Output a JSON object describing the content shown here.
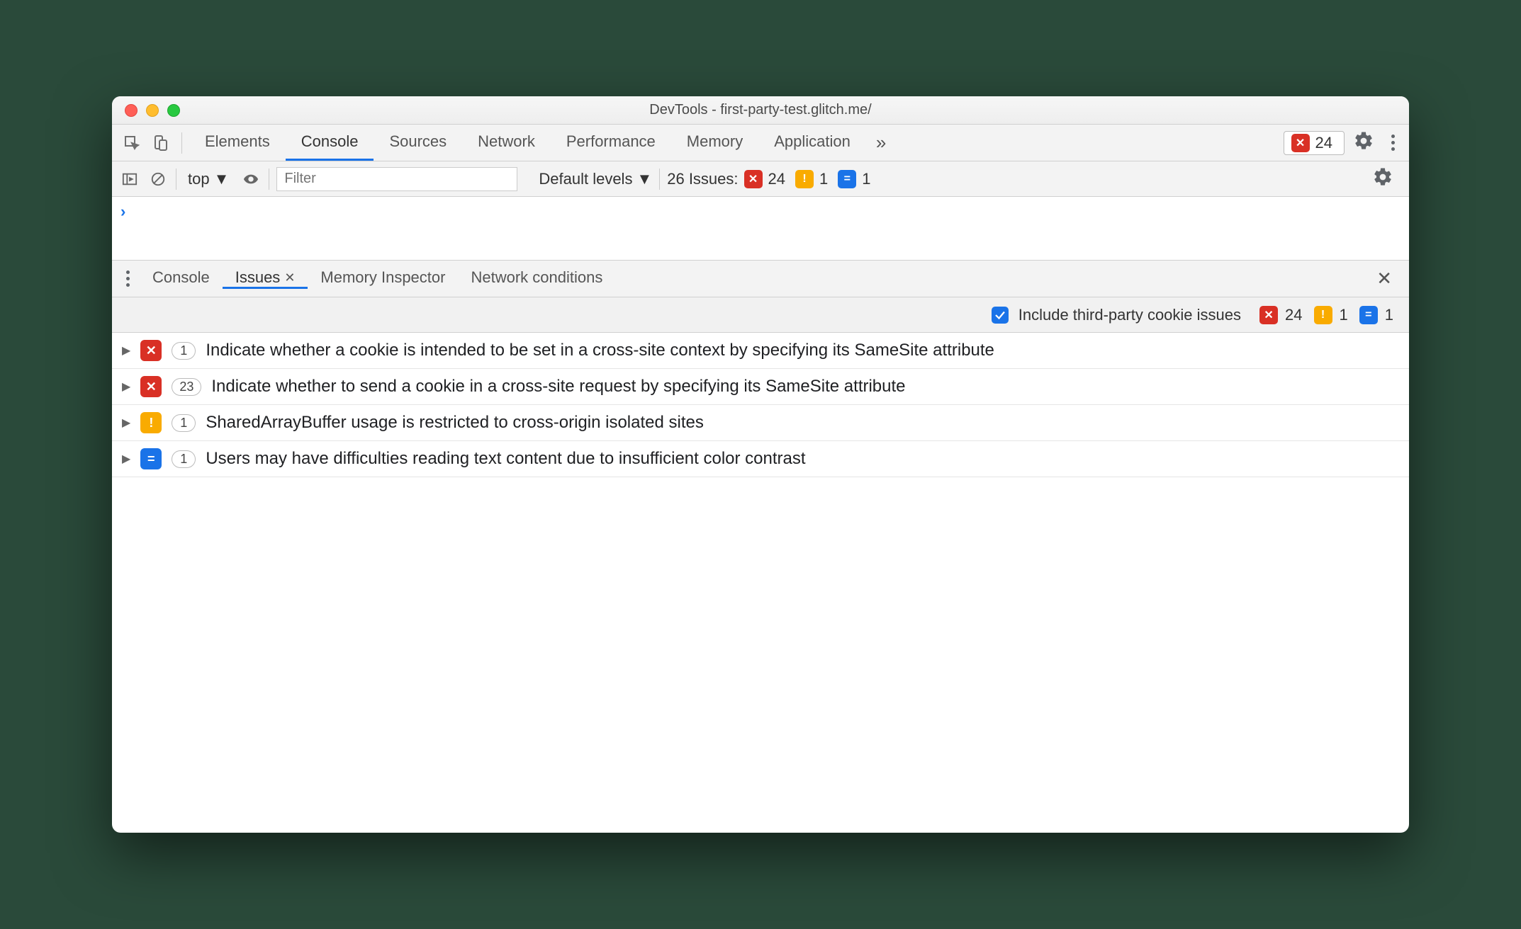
{
  "window": {
    "title": "DevTools - first-party-test.glitch.me/"
  },
  "main_tabs": {
    "items": [
      {
        "label": "Elements"
      },
      {
        "label": "Console"
      },
      {
        "label": "Sources"
      },
      {
        "label": "Network"
      },
      {
        "label": "Performance"
      },
      {
        "label": "Memory"
      },
      {
        "label": "Application"
      }
    ],
    "active_index": 1,
    "overflow_glyph": "»",
    "error_badge_count": "24"
  },
  "console_toolbar": {
    "context": "top",
    "filter_placeholder": "Filter",
    "levels_label": "Default levels",
    "issues_prefix": "26 Issues:",
    "red_count": "24",
    "yellow_count": "1",
    "blue_count": "1"
  },
  "drawer_tabs": {
    "items": [
      {
        "label": "Console"
      },
      {
        "label": "Issues"
      },
      {
        "label": "Memory Inspector"
      },
      {
        "label": "Network conditions"
      }
    ],
    "active_index": 1
  },
  "issues_toolbar": {
    "checkbox_checked": true,
    "checkbox_label": "Include third-party cookie issues",
    "red_count": "24",
    "yellow_count": "1",
    "blue_count": "1"
  },
  "issues": [
    {
      "severity": "red",
      "count": "1",
      "title": "Indicate whether a cookie is intended to be set in a cross-site context by specifying its SameSite attribute"
    },
    {
      "severity": "red",
      "count": "23",
      "title": "Indicate whether to send a cookie in a cross-site request by specifying its SameSite attribute"
    },
    {
      "severity": "yellow",
      "count": "1",
      "title": "SharedArrayBuffer usage is restricted to cross-origin isolated sites"
    },
    {
      "severity": "blue",
      "count": "1",
      "title": "Users may have difficulties reading text content due to insufficient color contrast"
    }
  ],
  "icon_glyphs": {
    "error": "✕",
    "warning": "!",
    "info": "="
  }
}
